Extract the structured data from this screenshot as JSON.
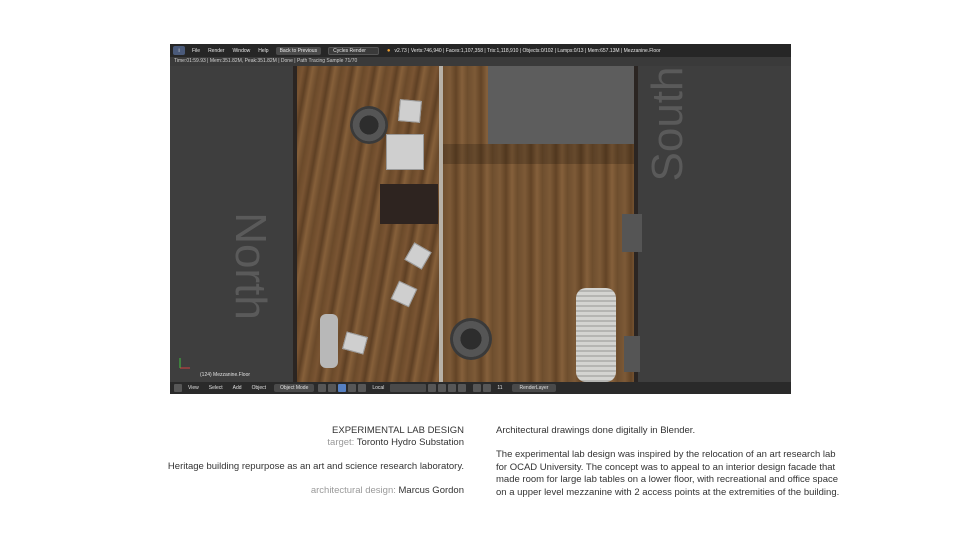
{
  "blender": {
    "menu": [
      "File",
      "Render",
      "Window",
      "Help"
    ],
    "back_button": "Back to Previous",
    "render_engine": "Cycles Render",
    "stats": "v2.73 | Verts:746,940 | Faces:1,107,358 | Tris:1,118,910 | Objects:0/102 | Lamps:0/13 | Mem:657.13M | Mezzanine.Floor",
    "render_status": "Time:01:59.93 | Mem:351.82M, Peak:351.82M | Done | Path Tracing Sample 71/70",
    "viewport_labels": {
      "north": "North",
      "south": "South"
    },
    "viewport_object": "(124) Mezzanine.Floor",
    "bottom_menu": [
      "View",
      "Select",
      "Add",
      "Object"
    ],
    "mode": "Object Mode",
    "pivot": "Local",
    "render_layer": "RenderLayer",
    "layer_number": "11",
    "accent_color": "#5680c2"
  },
  "captions": {
    "title": "EXPERIMENTAL LAB DESIGN",
    "target_label": "target:",
    "target_value": "Toronto Hydro Substation",
    "subtitle": "Heritage building repurpose as an art and science research laboratory.",
    "design_label": "architectural design:",
    "design_value": "Marcus Gordon",
    "desc_intro": "Architectural drawings done digitally in Blender.",
    "desc_body": "The experimental lab design was inspired by the relocation of an art research lab for OCAD University.  The concept was to appeal to an interior design facade that made room for large lab tables on a lower floor, with recreational and office space on a upper level mezzanine with 2 access points at the extremities of the building."
  }
}
